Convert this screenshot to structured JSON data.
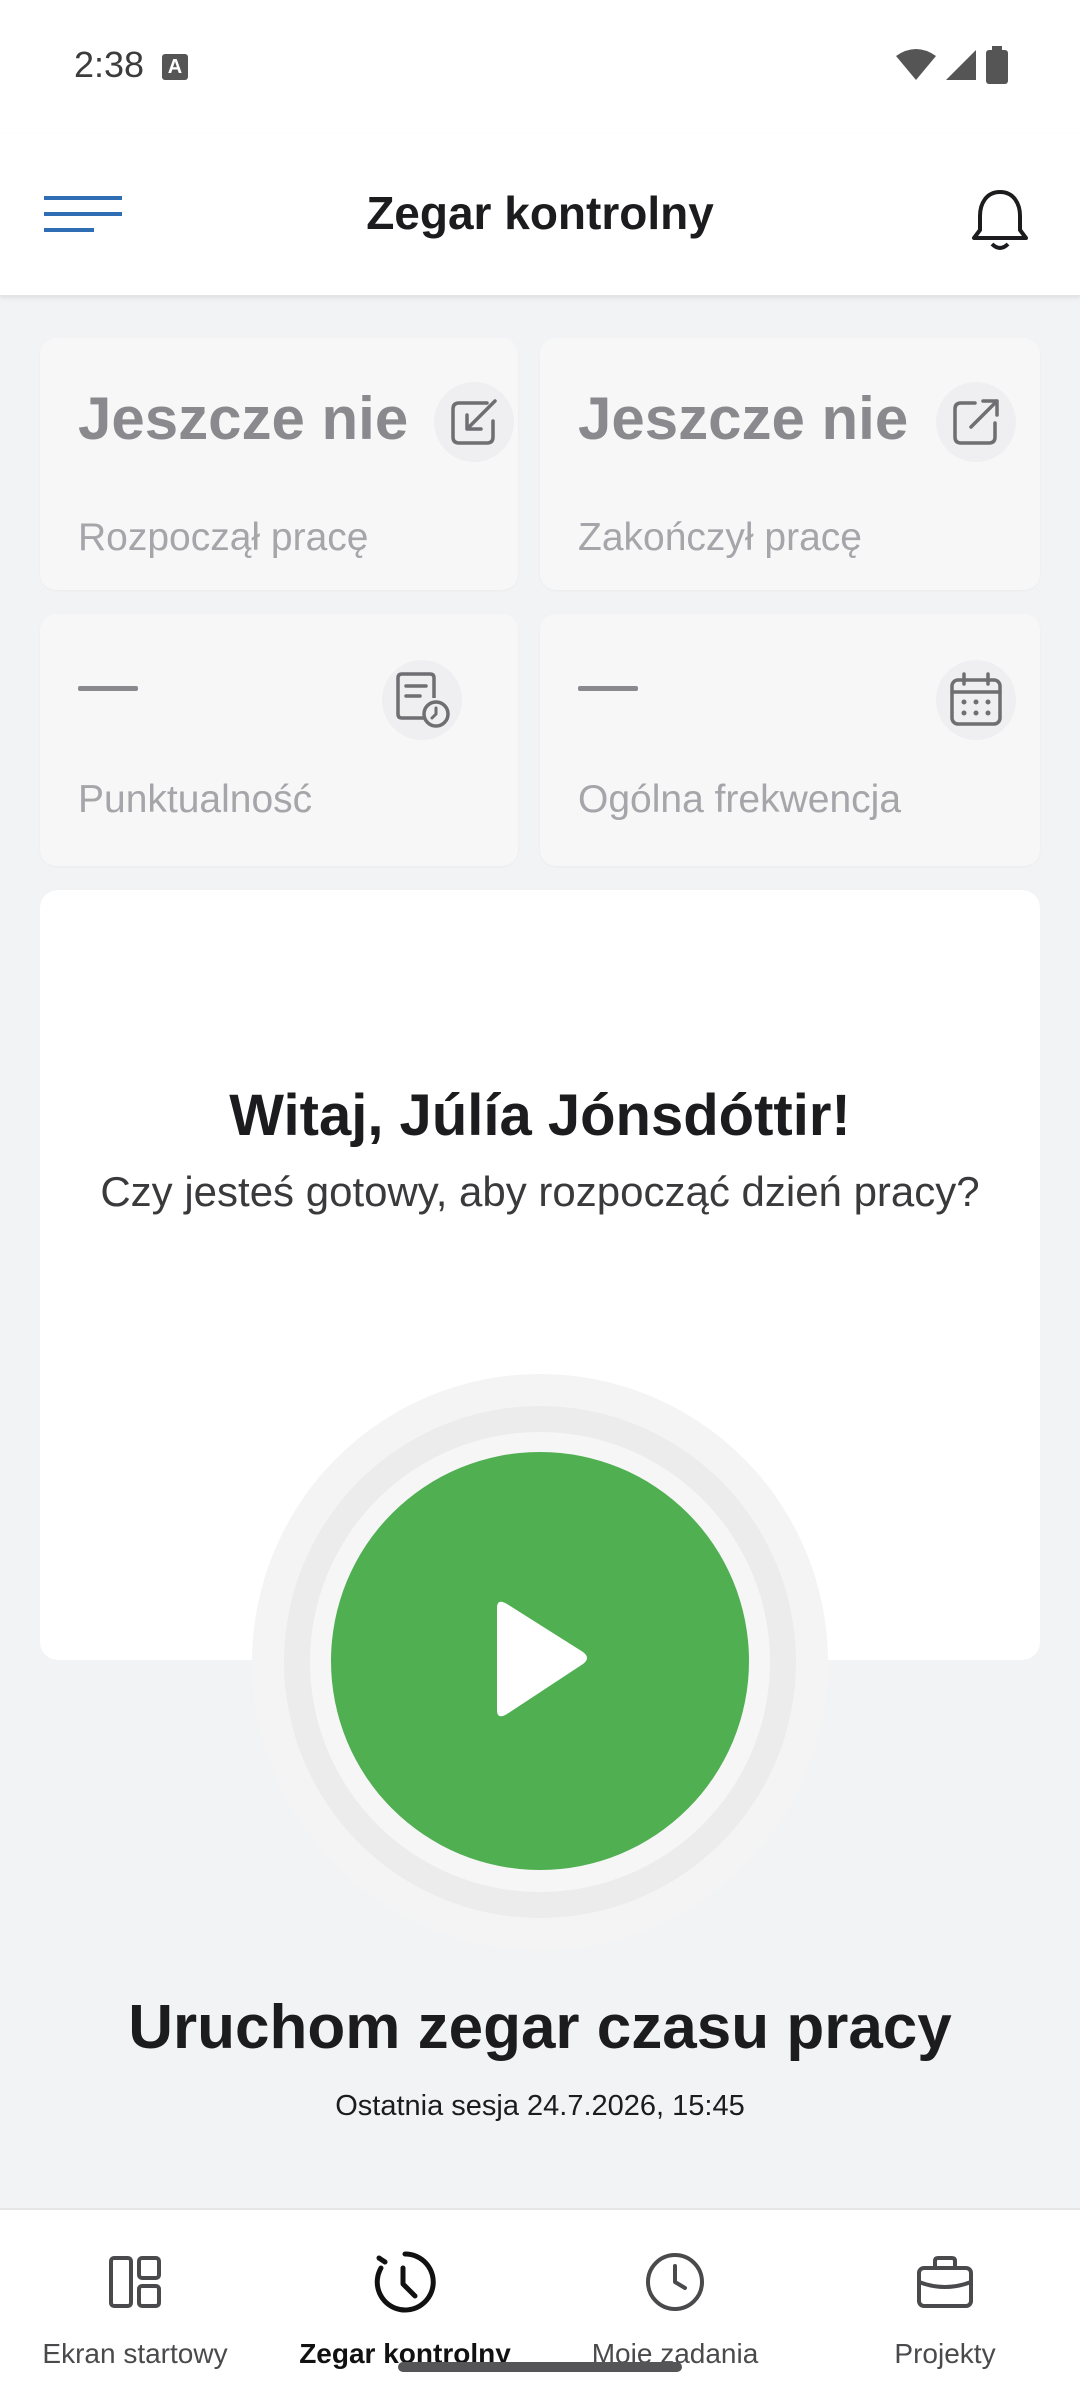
{
  "status_bar": {
    "time": "2:38",
    "notification_badge": "A"
  },
  "app_bar": {
    "title": "Zegar kontrolny",
    "accent_color": "#2f6db5"
  },
  "stats": [
    {
      "value": "Jeszcze nie",
      "label": "Rozpoczął pracę",
      "icon": "arrow-down-left-box-icon"
    },
    {
      "value": "Jeszcze nie",
      "label": "Zakończył pracę",
      "icon": "arrow-up-right-box-icon"
    },
    {
      "value": "—",
      "label": "Punktualność",
      "icon": "document-clock-icon"
    },
    {
      "value": "—",
      "label": "Ogólna frekwencja",
      "icon": "calendar-icon"
    }
  ],
  "welcome": {
    "title": "Witaj, Júlía Jónsdóttir!",
    "subtitle": "Czy jesteś gotowy, aby rozpocząć dzień pracy?"
  },
  "start": {
    "button_color": "#4faf51",
    "label": "Uruchom zegar czasu pracy",
    "last_session": "Ostatnia sesja 24.7.2026, 15:45"
  },
  "bottom_nav": {
    "items": [
      {
        "label": "Ekran startowy",
        "icon": "dashboard-icon",
        "active": false
      },
      {
        "label": "Zegar kontrolny",
        "icon": "clock-icon",
        "active": true
      },
      {
        "label": "Moje zadania",
        "icon": "clock-outline-icon",
        "active": false
      },
      {
        "label": "Projekty",
        "icon": "briefcase-icon",
        "active": false
      }
    ]
  }
}
